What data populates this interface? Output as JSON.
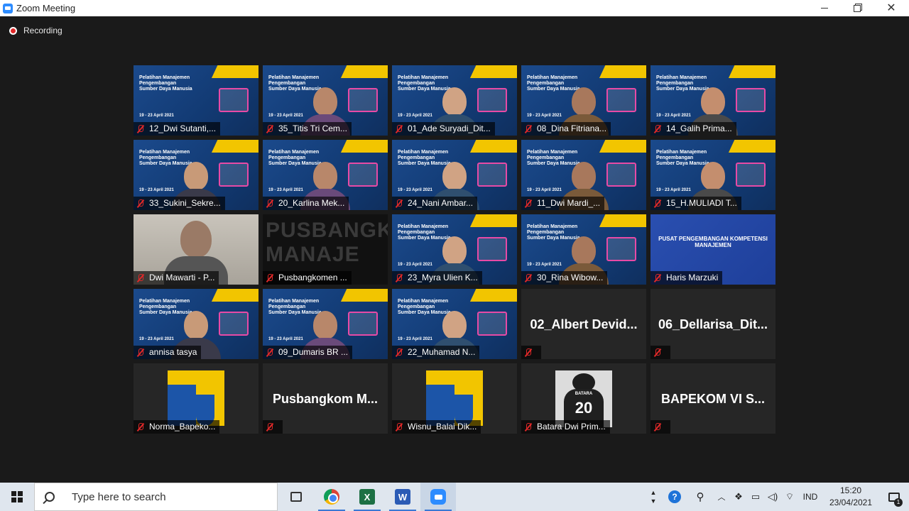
{
  "window": {
    "title": "Zoom Meeting",
    "minimize_icon": "minimize-icon",
    "restore_icon": "restore-icon",
    "close_icon": "close-icon"
  },
  "meeting": {
    "recording_label": "Recording"
  },
  "tiles": [
    {
      "name": "12_Dwi Sutanti,...",
      "kind": "banner"
    },
    {
      "name": "35_Titis Tri Cem...",
      "kind": "banner-person"
    },
    {
      "name": "01_Ade Suryadi_Dit...",
      "kind": "banner-person"
    },
    {
      "name": "08_Dina Fitriana...",
      "kind": "banner-person"
    },
    {
      "name": "14_Galih Prima...",
      "kind": "banner-person"
    },
    {
      "name": "33_Sukini_Sekre...",
      "kind": "banner-person"
    },
    {
      "name": "20_Karlina Mek...",
      "kind": "banner-person"
    },
    {
      "name": "24_Nani Ambar...",
      "kind": "banner-person"
    },
    {
      "name": "11_Dwi Mardi_...",
      "kind": "banner-person"
    },
    {
      "name": "15_H.MULIADI T...",
      "kind": "banner-person"
    },
    {
      "name": "Dwi Mawarti - P...",
      "kind": "room"
    },
    {
      "name": "Pusbangkomen ...",
      "kind": "dark-word",
      "overlay": "PUSBANGKO MANAJE"
    },
    {
      "name": "23_Myra Ulien K...",
      "kind": "banner-person"
    },
    {
      "name": "30_Rina Wibow...",
      "kind": "banner-person"
    },
    {
      "name": "Haris Marzuki",
      "kind": "pusat",
      "overlay": "PUSAT PENGEMBANGAN KOMPETENSI MANAJEMEN"
    },
    {
      "name": "annisa tasya",
      "kind": "banner-person"
    },
    {
      "name": "09_Dumaris BR ...",
      "kind": "banner-person"
    },
    {
      "name": "22_Muhamad N...",
      "kind": "banner-person"
    },
    {
      "name": "",
      "kind": "bigname",
      "big": "02_Albert Devid..."
    },
    {
      "name": "",
      "kind": "bigname",
      "big": "06_Dellarisa_Dit..."
    },
    {
      "name": "Norma_Bapeko...",
      "kind": "pu-logo"
    },
    {
      "name": "",
      "kind": "bigname",
      "big": "Pusbangkom M..."
    },
    {
      "name": "Wisnu_Balai Dik...",
      "kind": "pu-logo"
    },
    {
      "name": "Batara Dwi Prim...",
      "kind": "jersey",
      "jersey_name": "BATARA",
      "jersey_number": "20"
    },
    {
      "name": "",
      "kind": "bigname",
      "big": "BAPEKOM VI S..."
    }
  ],
  "banner": {
    "headline": "Pelatihan Manajemen Pengembangan Sumber Daya Manusia",
    "date": "19 - 23 April 2021"
  },
  "taskbar": {
    "search_placeholder": "Type here to search",
    "language": "IND",
    "time": "15:20",
    "date": "23/04/2021",
    "notification_count": "1",
    "excel_letter": "X",
    "word_letter": "W",
    "help_letter": "?"
  }
}
